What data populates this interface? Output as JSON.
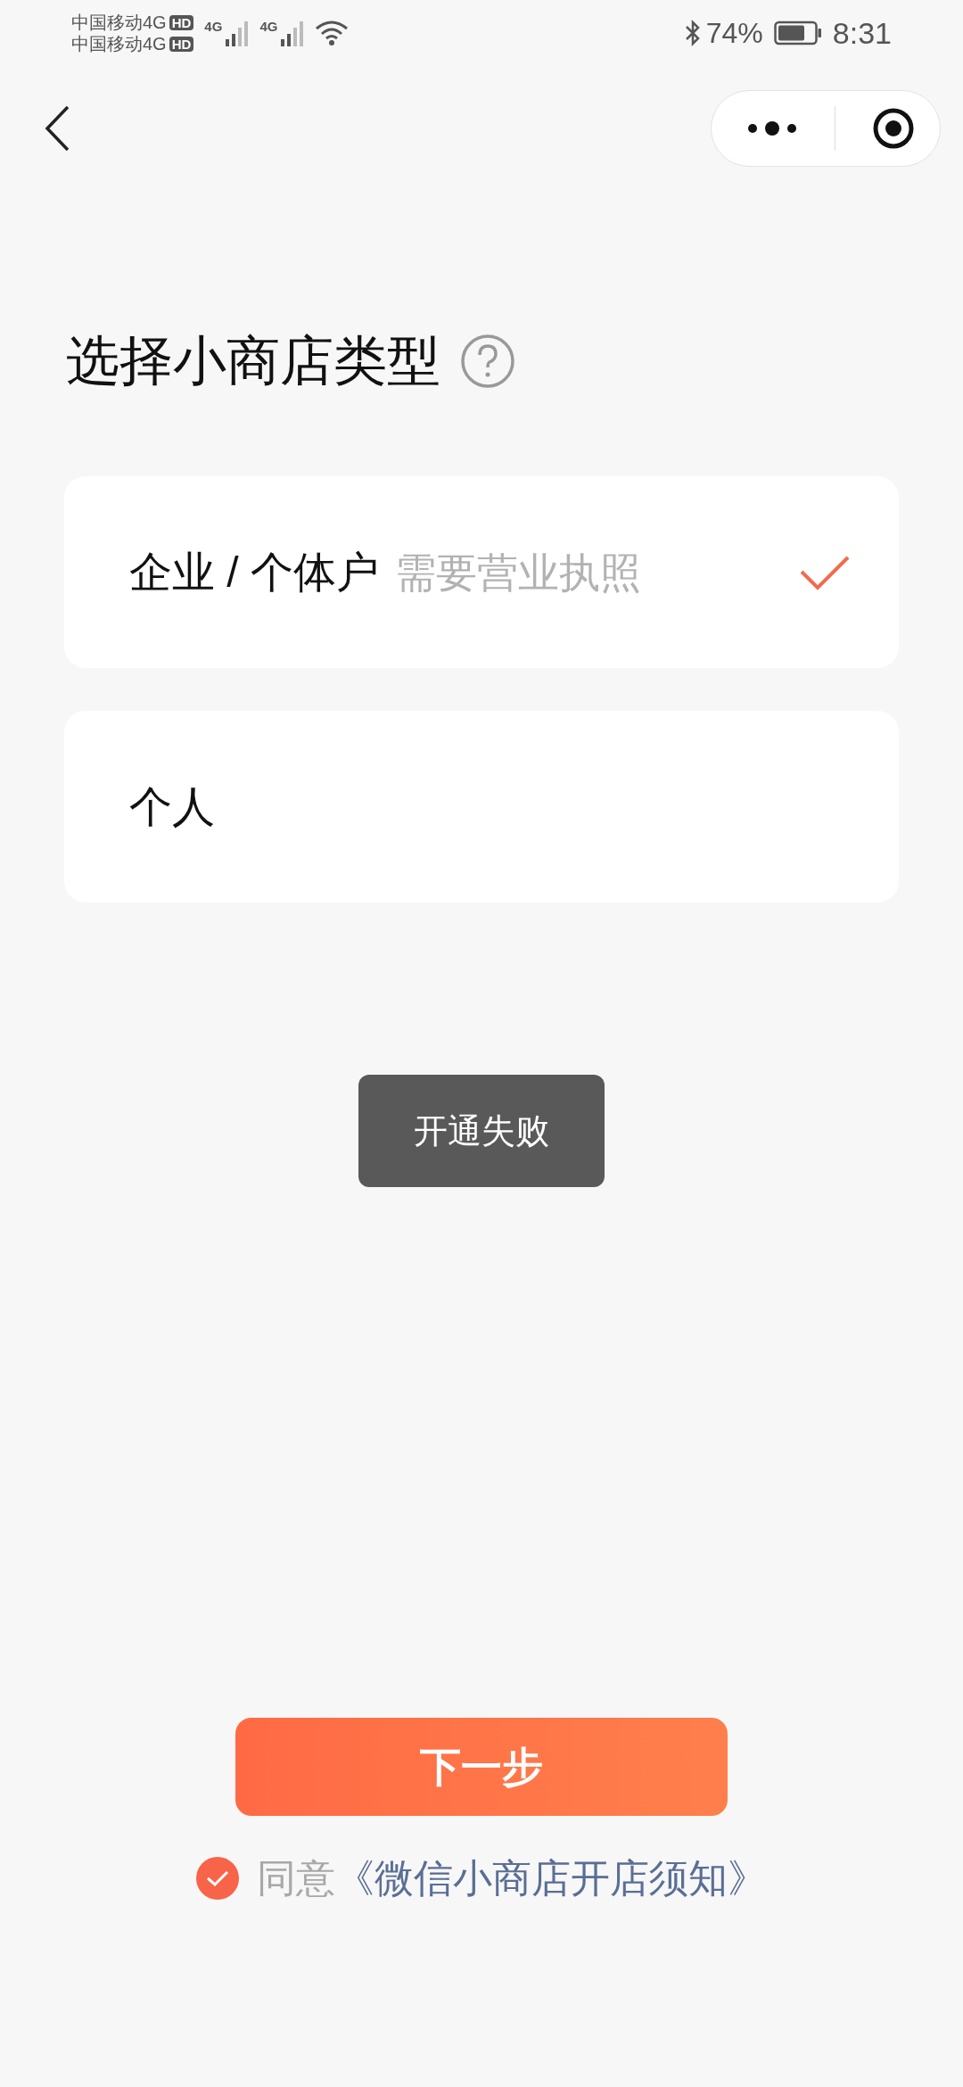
{
  "status_bar": {
    "carriers": [
      {
        "name": "中国移动4G",
        "badge": "HD"
      },
      {
        "name": "中国移动4G",
        "badge": "HD"
      }
    ],
    "networks": [
      "4G",
      "4G"
    ],
    "battery": "74%",
    "time": "8:31"
  },
  "title": "选择小商店类型",
  "options": [
    {
      "label": "企业 / 个体户",
      "hint": "需要营业执照",
      "selected": true
    },
    {
      "label": "个人",
      "selected": false
    }
  ],
  "toast": "开通失败",
  "next_button": "下一步",
  "agreement": {
    "checked": true,
    "prefix": "同意",
    "link": "《微信小商店开店须知》"
  }
}
